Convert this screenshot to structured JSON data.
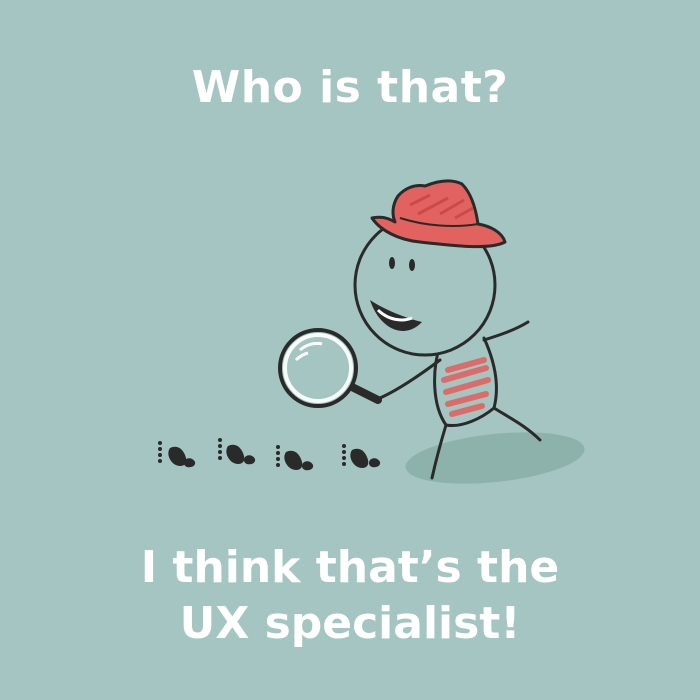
{
  "caption_top": "Who is that?",
  "caption_bottom": {
    "line1": "I think that’s the",
    "line2": "UX specialist!"
  },
  "colors": {
    "background": "#a4c5c1",
    "text": "#ffffff",
    "hat": "#e2625f",
    "ink": "#2a2a2a",
    "shadow": "#8fb3ae"
  }
}
